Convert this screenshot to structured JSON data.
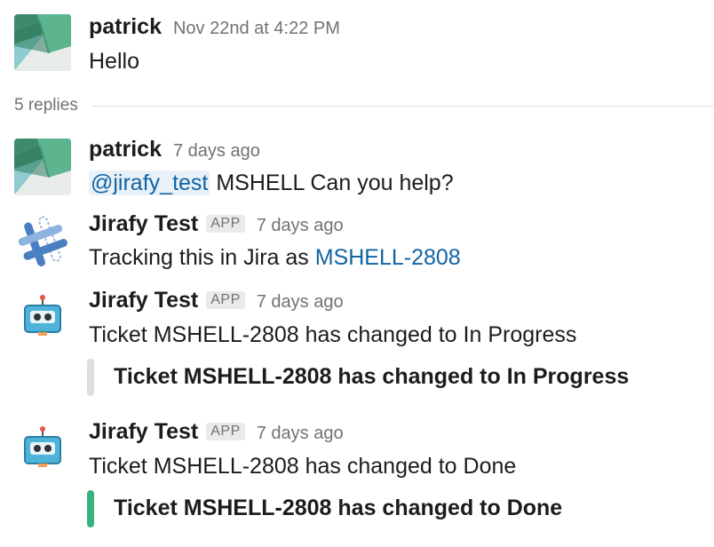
{
  "parent": {
    "sender": "patrick",
    "time": "Nov 22nd at 4:22 PM",
    "text": "Hello"
  },
  "thread": {
    "replies_label": "5 replies"
  },
  "replies": [
    {
      "sender": "patrick",
      "time": "7 days ago",
      "mention": "@jirafy_test",
      "text": "MSHELL Can you help?"
    },
    {
      "sender": "Jirafy Test",
      "badge": "APP",
      "time": "7 days ago",
      "text": "Tracking this in Jira as",
      "link": "MSHELL-2808"
    },
    {
      "sender": "Jirafy Test",
      "badge": "APP",
      "time": "7 days ago",
      "text": "Ticket MSHELL-2808 has changed to In Progress",
      "attachment": {
        "text": "Ticket MSHELL-2808 has changed to In Progress",
        "color": "#dddddd"
      }
    },
    {
      "sender": "Jirafy Test",
      "badge": "APP",
      "time": "7 days ago",
      "text": "Ticket MSHELL-2808 has changed to Done",
      "attachment": {
        "text": "Ticket MSHELL-2808 has changed to Done",
        "color": "#36b37e"
      }
    }
  ],
  "icons": {
    "user_avatar": "patrick-avatar-icon",
    "app_avatar": "jirafy-logo-icon",
    "bot_avatar": "robot-icon"
  }
}
